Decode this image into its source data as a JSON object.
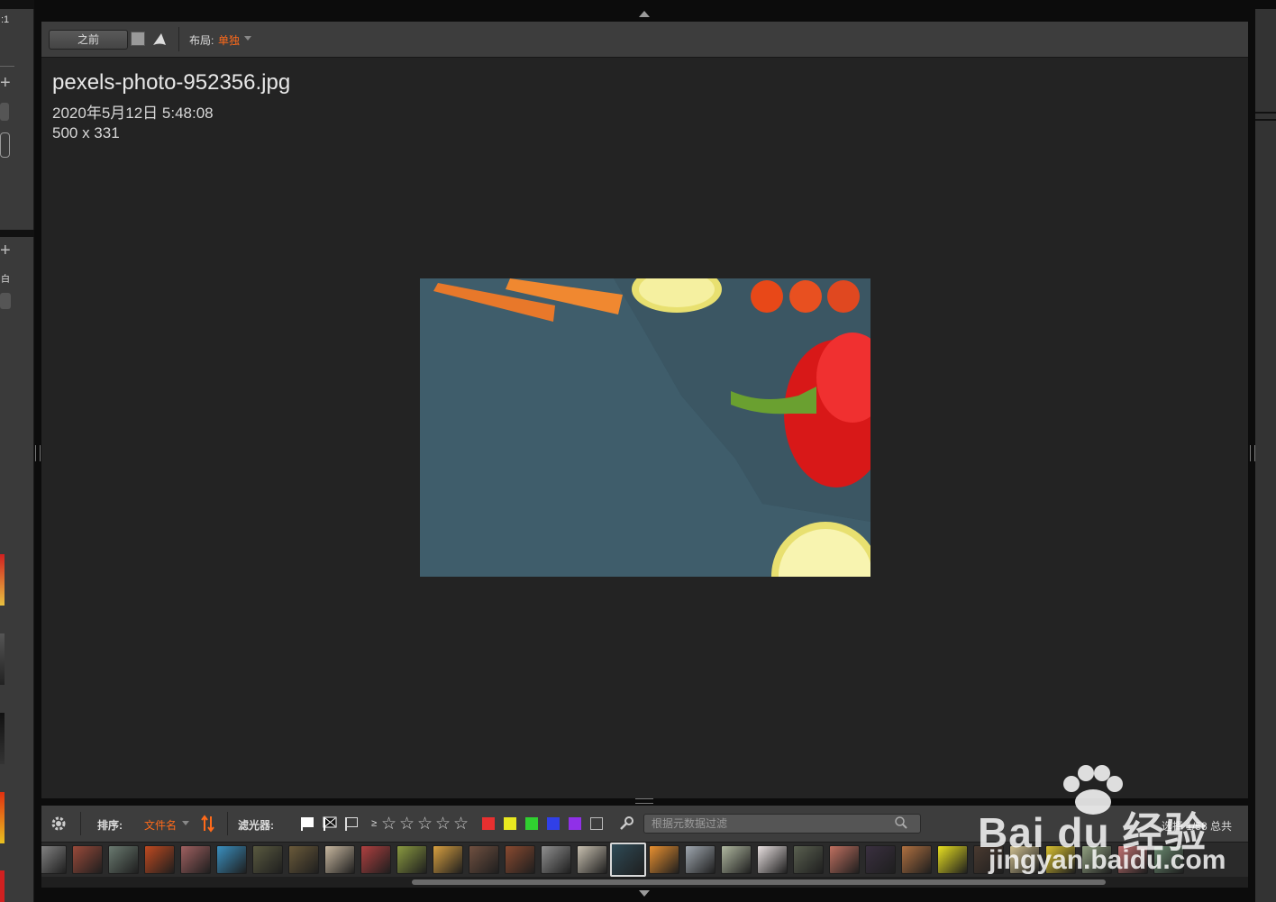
{
  "left_panel": {
    "zoom_label": ":1",
    "panel_glyph": "白"
  },
  "toolbar": {
    "before_label": "之前",
    "layout_label": "布局:",
    "layout_value": "单独"
  },
  "image_info": {
    "file_name": "pexels-photo-952356.jpg",
    "date": "2020年5月12日 5:48:08",
    "dimensions": "500 x 331"
  },
  "bottom_bar": {
    "sort_label": "排序:",
    "sort_value": "文件名",
    "filter_label": "滤光器:",
    "rating_prefix": "≥",
    "stars": [
      "☆",
      "☆",
      "☆",
      "☆",
      "☆"
    ],
    "color_labels": [
      "#e83030",
      "#e8e820",
      "#30d030",
      "#3040e8",
      "#9030e8"
    ],
    "search_placeholder": "根据元数据过滤",
    "count_text": "选择 1/58 总共"
  },
  "filmstrip": {
    "thumbnails": [
      "#8a8a8a",
      "#9a4a3a",
      "#6a7a70",
      "#c04a20",
      "#a06060",
      "#3a90c0",
      "#5a5a40",
      "#6a5a3a",
      "#c8b8a0",
      "#b04040",
      "#8a9a40",
      "#d8a040",
      "#705040",
      "#8a4a30",
      "#909090",
      "#c8c0b0",
      "#2f4b57",
      "#e89030",
      "#a0a8b0",
      "#b0b8a0",
      "#e8e0e0",
      "#5a6050",
      "#c07060",
      "#3a3040",
      "#b07040",
      "#e8e020",
      "#4a3a30",
      "#d0c090",
      "#d8c030",
      "#90a080",
      "#c07070",
      "#6a8a70"
    ],
    "selected_index": 16
  },
  "watermark": {
    "brand": "Bai du 经验",
    "url": "jingyan.baidu.com"
  }
}
